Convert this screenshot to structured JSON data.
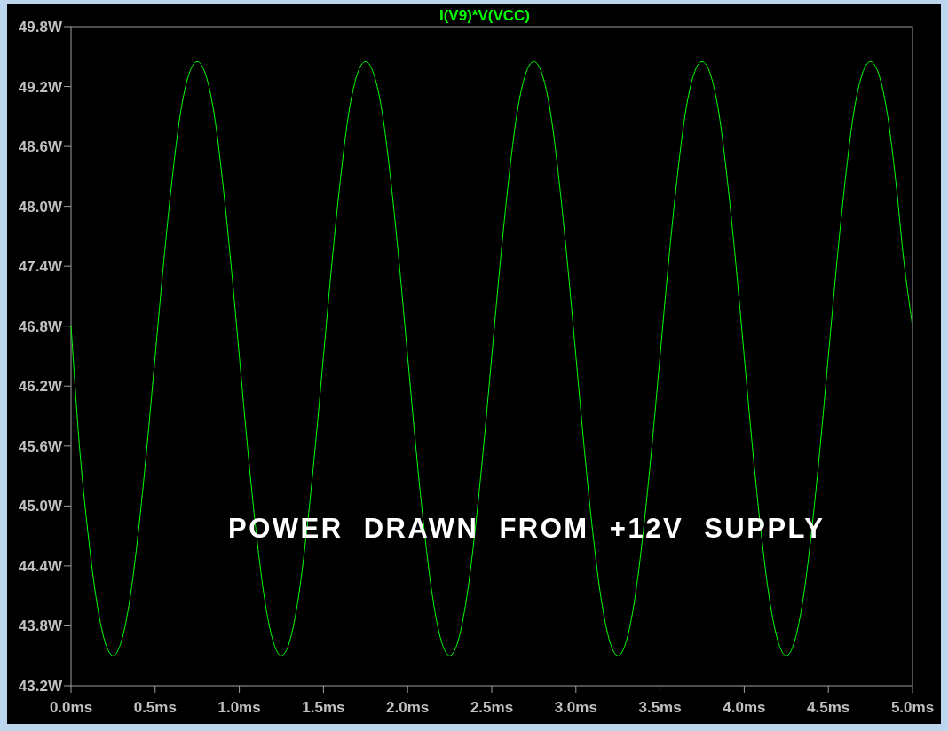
{
  "plot": {
    "chart_data": {
      "type": "line",
      "xlim": [
        0,
        5
      ],
      "ylim": [
        43.2,
        49.8
      ],
      "xticks": [
        {
          "value": 0,
          "label": "0.0ms"
        },
        {
          "value": 0.5,
          "label": "0.5ms"
        },
        {
          "value": 1,
          "label": "1.0ms"
        },
        {
          "value": 1.5,
          "label": "1.5ms"
        },
        {
          "value": 2,
          "label": "2.0ms"
        },
        {
          "value": 2.5,
          "label": "2.5ms"
        },
        {
          "value": 3,
          "label": "3.0ms"
        },
        {
          "value": 3.5,
          "label": "3.5ms"
        },
        {
          "value": 4,
          "label": "4.0ms"
        },
        {
          "value": 4.5,
          "label": "4.5ms"
        },
        {
          "value": 5,
          "label": "5.0ms"
        }
      ],
      "yticks": [
        {
          "value": 43.2,
          "label": "43.2W"
        },
        {
          "value": 43.8,
          "label": "43.8W"
        },
        {
          "value": 44.4,
          "label": "44.4W"
        },
        {
          "value": 45.0,
          "label": "45.0W"
        },
        {
          "value": 45.6,
          "label": "45.6W"
        },
        {
          "value": 46.2,
          "label": "46.2W"
        },
        {
          "value": 46.8,
          "label": "46.8W"
        },
        {
          "value": 47.4,
          "label": "47.4W"
        },
        {
          "value": 48.0,
          "label": "48.0W"
        },
        {
          "value": 48.6,
          "label": "48.6W"
        },
        {
          "value": 49.2,
          "label": "49.2W"
        },
        {
          "value": 49.8,
          "label": "49.8W"
        }
      ],
      "x": [
        0,
        0.05,
        0.1,
        0.15,
        0.2,
        0.25,
        0.3,
        0.35,
        0.4,
        0.45,
        0.5,
        0.55,
        0.6,
        0.65,
        0.7,
        0.75,
        0.8,
        0.85,
        0.9,
        0.95,
        1,
        1.05,
        1.1,
        1.15,
        1.2,
        1.25,
        1.3,
        1.35,
        1.4,
        1.45,
        1.5,
        1.55,
        1.6,
        1.65,
        1.7,
        1.75,
        1.8,
        1.85,
        1.9,
        1.95,
        2,
        2.05,
        2.1,
        2.15,
        2.2,
        2.25,
        2.3,
        2.35,
        2.4,
        2.45,
        2.5,
        2.55,
        2.6,
        2.65,
        2.7,
        2.75,
        2.8,
        2.85,
        2.9,
        2.95,
        3,
        3.05,
        3.1,
        3.15,
        3.2,
        3.25,
        3.3,
        3.35,
        3.4,
        3.45,
        3.5,
        3.55,
        3.6,
        3.65,
        3.7,
        3.75,
        3.8,
        3.85,
        3.9,
        3.95,
        4,
        4.05,
        4.1,
        4.15,
        4.2,
        4.25,
        4.3,
        4.35,
        4.4,
        4.45,
        4.5,
        4.55,
        4.6,
        4.65,
        4.7,
        4.75,
        4.8,
        4.85,
        4.9,
        4.95,
        5
      ],
      "series": [
        {
          "name": "I(V9)*V(VCC)",
          "color": "#00ff00",
          "values": [
            46.8,
            45.6,
            44.74,
            44.07,
            43.65,
            43.5,
            43.65,
            44.07,
            44.74,
            45.57,
            46.5,
            47.43,
            48.26,
            48.93,
            49.32,
            49.45,
            49.32,
            48.93,
            48.26,
            47.43,
            46.5,
            45.57,
            44.74,
            44.07,
            43.65,
            43.5,
            43.65,
            44.07,
            44.74,
            45.57,
            46.5,
            47.43,
            48.26,
            48.93,
            49.32,
            49.45,
            49.32,
            48.93,
            48.26,
            47.43,
            46.5,
            45.57,
            44.74,
            44.07,
            43.65,
            43.5,
            43.65,
            44.07,
            44.74,
            45.57,
            46.5,
            47.43,
            48.26,
            48.93,
            49.32,
            49.45,
            49.32,
            48.93,
            48.26,
            47.43,
            46.5,
            45.57,
            44.74,
            44.07,
            43.65,
            43.5,
            43.65,
            44.07,
            44.74,
            45.57,
            46.5,
            47.43,
            48.26,
            48.93,
            49.32,
            49.45,
            49.32,
            48.93,
            48.26,
            47.43,
            46.5,
            45.57,
            44.74,
            44.07,
            43.65,
            43.5,
            43.65,
            44.07,
            44.74,
            45.57,
            46.5,
            47.43,
            48.26,
            48.93,
            49.32,
            49.45,
            49.32,
            48.93,
            48.26,
            47.43,
            46.8
          ]
        }
      ],
      "annotations": [
        "POWER DRAWN FROM +12V SUPPLY"
      ]
    }
  }
}
